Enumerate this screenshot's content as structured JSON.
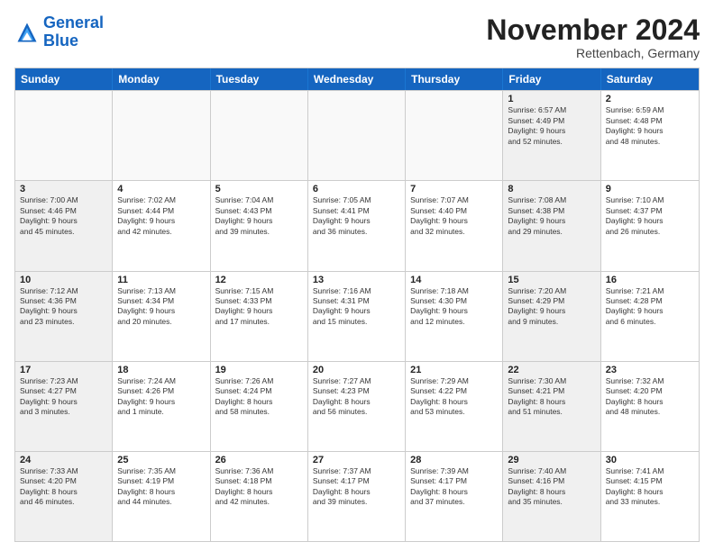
{
  "logo": {
    "line1": "General",
    "line2": "Blue"
  },
  "title": "November 2024",
  "location": "Rettenbach, Germany",
  "header_days": [
    "Sunday",
    "Monday",
    "Tuesday",
    "Wednesday",
    "Thursday",
    "Friday",
    "Saturday"
  ],
  "rows": [
    [
      {
        "day": "",
        "detail": "",
        "empty": true
      },
      {
        "day": "",
        "detail": "",
        "empty": true
      },
      {
        "day": "",
        "detail": "",
        "empty": true
      },
      {
        "day": "",
        "detail": "",
        "empty": true
      },
      {
        "day": "",
        "detail": "",
        "empty": true
      },
      {
        "day": "1",
        "detail": "Sunrise: 6:57 AM\nSunset: 4:49 PM\nDaylight: 9 hours\nand 52 minutes.",
        "shaded": true
      },
      {
        "day": "2",
        "detail": "Sunrise: 6:59 AM\nSunset: 4:48 PM\nDaylight: 9 hours\nand 48 minutes.",
        "shaded": false
      }
    ],
    [
      {
        "day": "3",
        "detail": "Sunrise: 7:00 AM\nSunset: 4:46 PM\nDaylight: 9 hours\nand 45 minutes.",
        "shaded": true
      },
      {
        "day": "4",
        "detail": "Sunrise: 7:02 AM\nSunset: 4:44 PM\nDaylight: 9 hours\nand 42 minutes.",
        "shaded": false
      },
      {
        "day": "5",
        "detail": "Sunrise: 7:04 AM\nSunset: 4:43 PM\nDaylight: 9 hours\nand 39 minutes.",
        "shaded": false
      },
      {
        "day": "6",
        "detail": "Sunrise: 7:05 AM\nSunset: 4:41 PM\nDaylight: 9 hours\nand 36 minutes.",
        "shaded": false
      },
      {
        "day": "7",
        "detail": "Sunrise: 7:07 AM\nSunset: 4:40 PM\nDaylight: 9 hours\nand 32 minutes.",
        "shaded": false
      },
      {
        "day": "8",
        "detail": "Sunrise: 7:08 AM\nSunset: 4:38 PM\nDaylight: 9 hours\nand 29 minutes.",
        "shaded": true
      },
      {
        "day": "9",
        "detail": "Sunrise: 7:10 AM\nSunset: 4:37 PM\nDaylight: 9 hours\nand 26 minutes.",
        "shaded": false
      }
    ],
    [
      {
        "day": "10",
        "detail": "Sunrise: 7:12 AM\nSunset: 4:36 PM\nDaylight: 9 hours\nand 23 minutes.",
        "shaded": true
      },
      {
        "day": "11",
        "detail": "Sunrise: 7:13 AM\nSunset: 4:34 PM\nDaylight: 9 hours\nand 20 minutes.",
        "shaded": false
      },
      {
        "day": "12",
        "detail": "Sunrise: 7:15 AM\nSunset: 4:33 PM\nDaylight: 9 hours\nand 17 minutes.",
        "shaded": false
      },
      {
        "day": "13",
        "detail": "Sunrise: 7:16 AM\nSunset: 4:31 PM\nDaylight: 9 hours\nand 15 minutes.",
        "shaded": false
      },
      {
        "day": "14",
        "detail": "Sunrise: 7:18 AM\nSunset: 4:30 PM\nDaylight: 9 hours\nand 12 minutes.",
        "shaded": false
      },
      {
        "day": "15",
        "detail": "Sunrise: 7:20 AM\nSunset: 4:29 PM\nDaylight: 9 hours\nand 9 minutes.",
        "shaded": true
      },
      {
        "day": "16",
        "detail": "Sunrise: 7:21 AM\nSunset: 4:28 PM\nDaylight: 9 hours\nand 6 minutes.",
        "shaded": false
      }
    ],
    [
      {
        "day": "17",
        "detail": "Sunrise: 7:23 AM\nSunset: 4:27 PM\nDaylight: 9 hours\nand 3 minutes.",
        "shaded": true
      },
      {
        "day": "18",
        "detail": "Sunrise: 7:24 AM\nSunset: 4:26 PM\nDaylight: 9 hours\nand 1 minute.",
        "shaded": false
      },
      {
        "day": "19",
        "detail": "Sunrise: 7:26 AM\nSunset: 4:24 PM\nDaylight: 8 hours\nand 58 minutes.",
        "shaded": false
      },
      {
        "day": "20",
        "detail": "Sunrise: 7:27 AM\nSunset: 4:23 PM\nDaylight: 8 hours\nand 56 minutes.",
        "shaded": false
      },
      {
        "day": "21",
        "detail": "Sunrise: 7:29 AM\nSunset: 4:22 PM\nDaylight: 8 hours\nand 53 minutes.",
        "shaded": false
      },
      {
        "day": "22",
        "detail": "Sunrise: 7:30 AM\nSunset: 4:21 PM\nDaylight: 8 hours\nand 51 minutes.",
        "shaded": true
      },
      {
        "day": "23",
        "detail": "Sunrise: 7:32 AM\nSunset: 4:20 PM\nDaylight: 8 hours\nand 48 minutes.",
        "shaded": false
      }
    ],
    [
      {
        "day": "24",
        "detail": "Sunrise: 7:33 AM\nSunset: 4:20 PM\nDaylight: 8 hours\nand 46 minutes.",
        "shaded": true
      },
      {
        "day": "25",
        "detail": "Sunrise: 7:35 AM\nSunset: 4:19 PM\nDaylight: 8 hours\nand 44 minutes.",
        "shaded": false
      },
      {
        "day": "26",
        "detail": "Sunrise: 7:36 AM\nSunset: 4:18 PM\nDaylight: 8 hours\nand 42 minutes.",
        "shaded": false
      },
      {
        "day": "27",
        "detail": "Sunrise: 7:37 AM\nSunset: 4:17 PM\nDaylight: 8 hours\nand 39 minutes.",
        "shaded": false
      },
      {
        "day": "28",
        "detail": "Sunrise: 7:39 AM\nSunset: 4:17 PM\nDaylight: 8 hours\nand 37 minutes.",
        "shaded": false
      },
      {
        "day": "29",
        "detail": "Sunrise: 7:40 AM\nSunset: 4:16 PM\nDaylight: 8 hours\nand 35 minutes.",
        "shaded": true
      },
      {
        "day": "30",
        "detail": "Sunrise: 7:41 AM\nSunset: 4:15 PM\nDaylight: 8 hours\nand 33 minutes.",
        "shaded": false
      }
    ]
  ]
}
